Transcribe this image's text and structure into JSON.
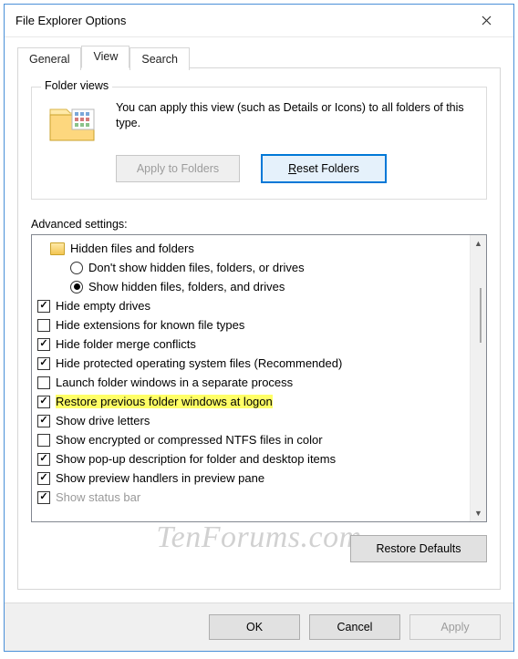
{
  "window": {
    "title": "File Explorer Options"
  },
  "tabs": {
    "general": "General",
    "view": "View",
    "search": "Search",
    "active": "view"
  },
  "folder_views": {
    "legend": "Folder views",
    "text": "You can apply this view (such as Details or Icons) to all folders of this type.",
    "apply_btn": "Apply to Folders",
    "reset_btn_pre": "R",
    "reset_btn_rest": "eset Folders"
  },
  "advanced": {
    "label": "Advanced settings:",
    "items": [
      {
        "type": "folder",
        "indent": 1,
        "text": "Hidden files and folders"
      },
      {
        "type": "radio",
        "indent": 2,
        "selected": false,
        "text": "Don't show hidden files, folders, or drives"
      },
      {
        "type": "radio",
        "indent": 2,
        "selected": true,
        "text": "Show hidden files, folders, and drives"
      },
      {
        "type": "check",
        "indent": 0,
        "checked": true,
        "text": "Hide empty drives"
      },
      {
        "type": "check",
        "indent": 0,
        "checked": false,
        "text": "Hide extensions for known file types"
      },
      {
        "type": "check",
        "indent": 0,
        "checked": true,
        "text": "Hide folder merge conflicts"
      },
      {
        "type": "check",
        "indent": 0,
        "checked": true,
        "text": "Hide protected operating system files (Recommended)"
      },
      {
        "type": "check",
        "indent": 0,
        "checked": false,
        "text": "Launch folder windows in a separate process"
      },
      {
        "type": "check",
        "indent": 0,
        "checked": true,
        "highlight": true,
        "text": "Restore previous folder windows at logon"
      },
      {
        "type": "check",
        "indent": 0,
        "checked": true,
        "text": "Show drive letters"
      },
      {
        "type": "check",
        "indent": 0,
        "checked": false,
        "text": "Show encrypted or compressed NTFS files in color"
      },
      {
        "type": "check",
        "indent": 0,
        "checked": true,
        "text": "Show pop-up description for folder and desktop items"
      },
      {
        "type": "check",
        "indent": 0,
        "checked": true,
        "text": "Show preview handlers in preview pane"
      },
      {
        "type": "check",
        "indent": 0,
        "checked": true,
        "cut": true,
        "text": "Show status bar"
      }
    ],
    "restore_btn": "Restore Defaults"
  },
  "footer": {
    "ok": "OK",
    "cancel": "Cancel",
    "apply": "Apply"
  },
  "watermark": "TenForums.com"
}
